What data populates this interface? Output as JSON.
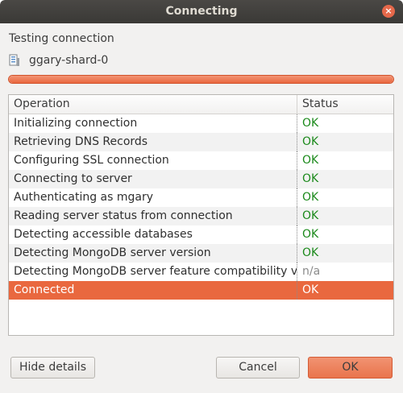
{
  "window": {
    "title": "Connecting",
    "close_label": "×"
  },
  "status": {
    "text": "Testing connection"
  },
  "server": {
    "name": "ggary-shard-0",
    "icon": "server-icon"
  },
  "progress": {
    "value": 1.0
  },
  "table": {
    "headers": {
      "operation": "Operation",
      "status": "Status"
    },
    "rows": [
      {
        "operation": "Initializing connection",
        "status": "OK"
      },
      {
        "operation": "Retrieving DNS Records",
        "status": "OK"
      },
      {
        "operation": "Configuring SSL connection",
        "status": "OK"
      },
      {
        "operation": "Connecting to server",
        "status": "OK"
      },
      {
        "operation": "Authenticating as mgary",
        "status": "OK"
      },
      {
        "operation": "Reading server status from connection",
        "status": "OK"
      },
      {
        "operation": "Detecting accessible databases",
        "status": "OK"
      },
      {
        "operation": "Detecting MongoDB server version",
        "status": "OK"
      },
      {
        "operation": "Detecting MongoDB server feature compatibility version",
        "status": "n/a"
      },
      {
        "operation": "Connected",
        "status": "OK"
      }
    ]
  },
  "buttons": {
    "hide_details": "Hide details",
    "cancel": "Cancel",
    "ok": "OK"
  },
  "colors": {
    "accent": "#e9683f",
    "ok_status": "#1c8a1c",
    "titlebar": "#3c3b37"
  }
}
